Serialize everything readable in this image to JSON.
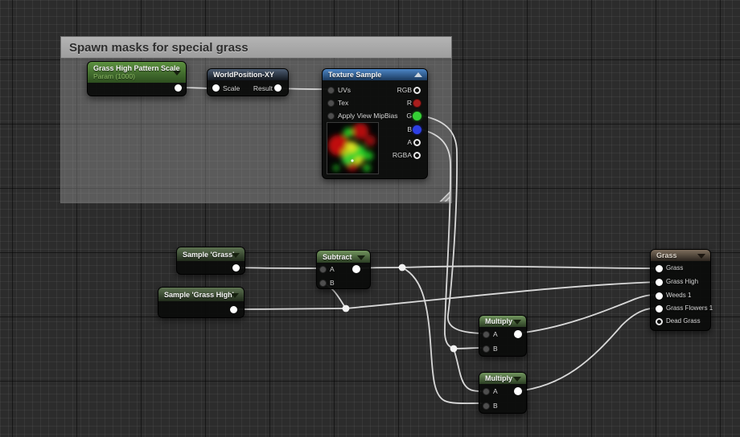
{
  "comment": {
    "title": "Spawn masks for special grass"
  },
  "nodes": {
    "param": {
      "title": "Grass High Pattern Scale",
      "subtitle": "Param (1000)"
    },
    "worldpos": {
      "title": "WorldPosition-XY",
      "scale_label": "Scale",
      "result_label": "Result"
    },
    "texture": {
      "title": "Texture Sample",
      "in_uvs": "UVs",
      "in_tex": "Tex",
      "in_mip": "Apply View MipBias",
      "out_rgb": "RGB",
      "out_r": "R",
      "out_g": "G",
      "out_b": "B",
      "out_a": "A",
      "out_rgba": "RGBA"
    },
    "sample_grass": {
      "title": "Sample 'Grass'"
    },
    "sample_grass_high": {
      "title": "Sample 'Grass High'"
    },
    "subtract": {
      "title": "Subtract",
      "in_a": "A",
      "in_b": "B"
    },
    "multiply_top": {
      "title": "Multiply",
      "in_a": "A",
      "in_b": "B"
    },
    "multiply_bottom": {
      "title": "Multiply",
      "in_a": "A",
      "in_b": "B"
    },
    "grass_output": {
      "title": "Grass",
      "pins": [
        "Grass",
        "Grass High",
        "Weeds 1",
        "Grass Flowers 1",
        "Dead Grass"
      ]
    }
  },
  "colors": {
    "wire": "#d9d9d9",
    "pin_r": "#a81d1d",
    "pin_g": "#35d035",
    "pin_b": "#2d3fe6",
    "header_function_green": "#72955e",
    "header_texture_blue": "#4c86c6",
    "header_worldpos_slate": "#4d5d72",
    "header_param_green": "#5d9140",
    "header_output_brown": "#7e6e5d",
    "comment_gray": "#9e9e9e"
  }
}
